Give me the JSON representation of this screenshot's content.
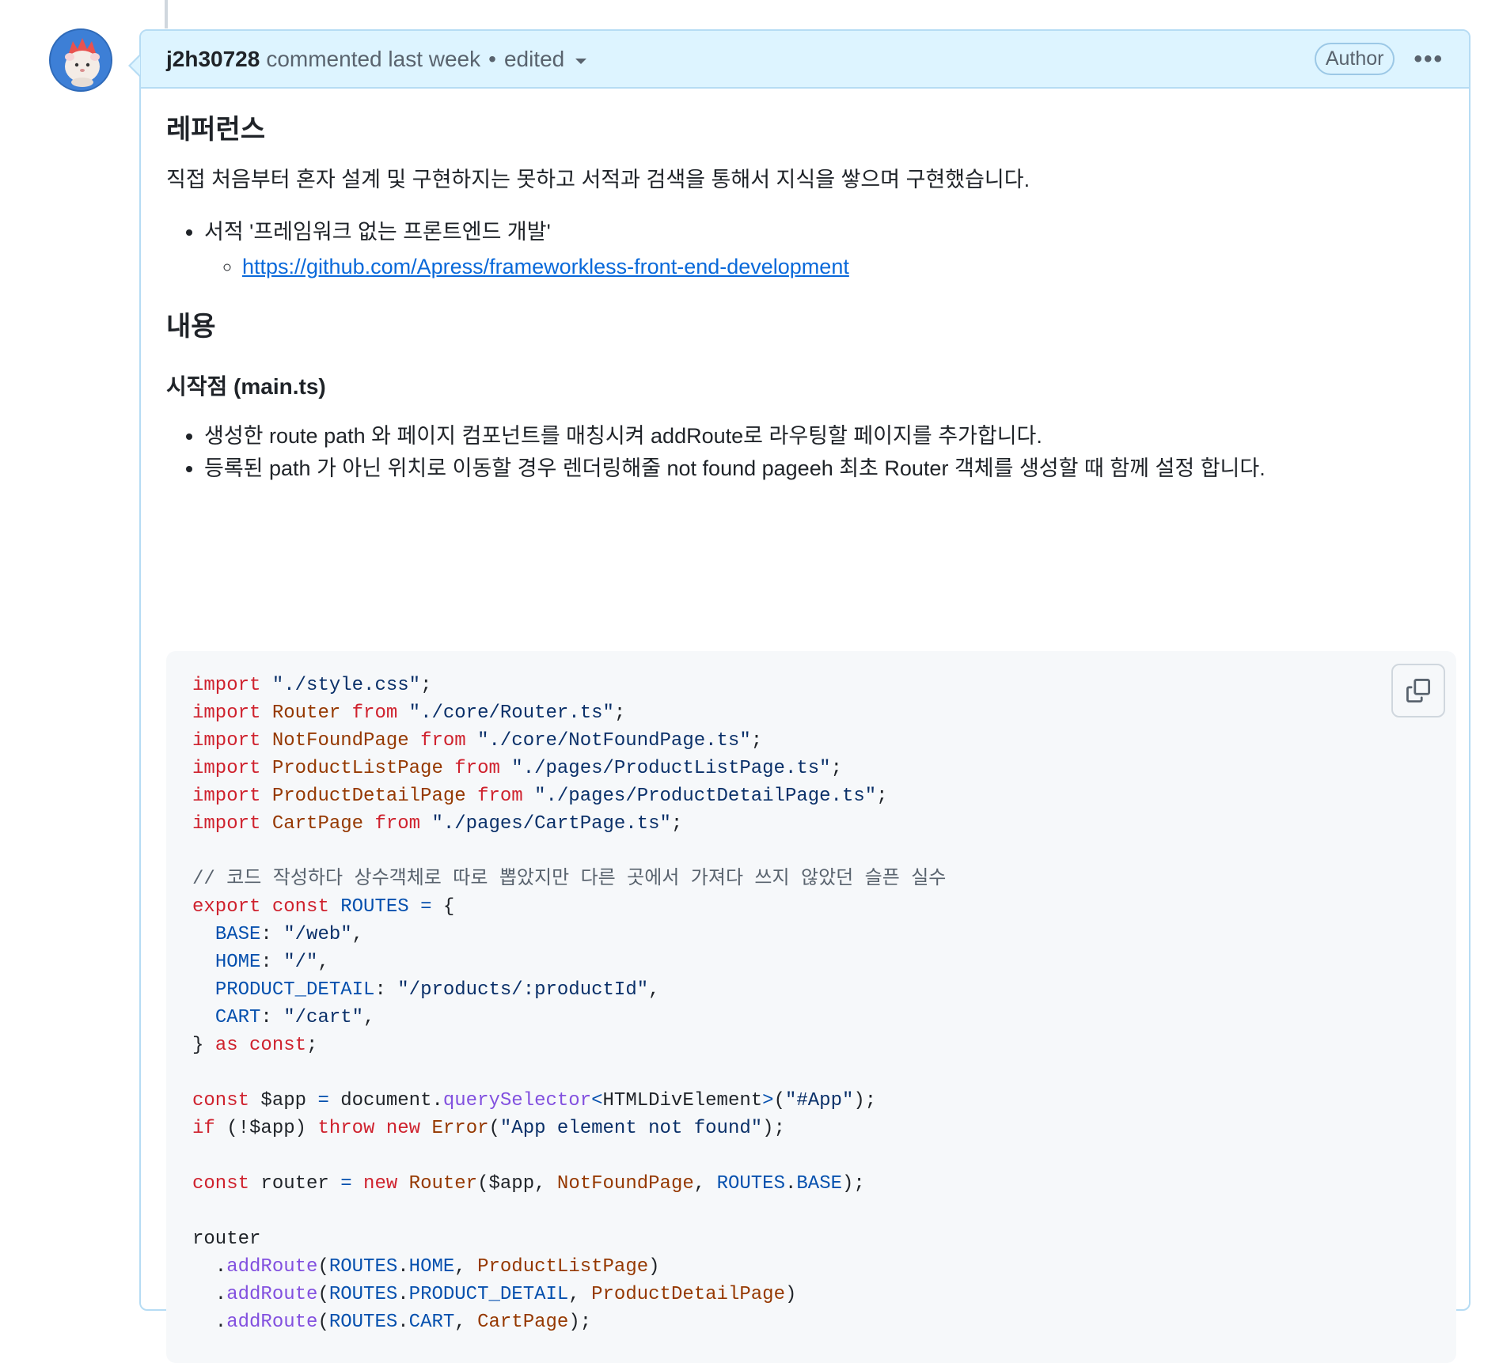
{
  "comment": {
    "author": "j2h30728",
    "action_text": "commented last week",
    "separator": "•",
    "edited_label": "edited",
    "author_badge": "Author",
    "menu_label": "•••"
  },
  "content": {
    "heading_reference": "레퍼런스",
    "intro": "직접 처음부터 혼자 설계 및 구현하지는 못하고 서적과 검색을 통해서 지식을 쌓으며 구현했습니다.",
    "book_item": "서적 '프레임워크 없는 프론트엔드 개발'",
    "book_link": "https://github.com/Apress/frameworkless-front-end-development",
    "heading_content": "내용",
    "subheading_entry": "시작점 (main.ts)",
    "bullet_1": "생성한 route path 와 페이지 컴포넌트를 매칭시켜 addRoute로 라우팅할 페이지를 추가합니다.",
    "bullet_2": "등록된 path 가 아닌 위치로 이동할 경우 렌더링해줄 not found pageeh 최초 Router 객체를 생성할 때 함께 설정 합니다."
  },
  "code": {
    "language": "ts",
    "comment_line": "// 코드 작성하다 상수객체로 따로 뽑았지만 다른 곳에서 가져다 쓰지 않았던 슬픈 실수",
    "imports": [
      {
        "name": "",
        "path": "\"./style.css\""
      },
      {
        "name": "Router",
        "path": "\"./core/Router.ts\""
      },
      {
        "name": "NotFoundPage",
        "path": "\"./core/NotFoundPage.ts\""
      },
      {
        "name": "ProductListPage",
        "path": "\"./pages/ProductListPage.ts\""
      },
      {
        "name": "ProductDetailPage",
        "path": "\"./pages/ProductDetailPage.ts\""
      },
      {
        "name": "CartPage",
        "path": "\"./pages/CartPage.ts\""
      }
    ],
    "routes": [
      {
        "key": "BASE",
        "value": "\"/web\""
      },
      {
        "key": "HOME",
        "value": "\"/\""
      },
      {
        "key": "PRODUCT_DETAIL",
        "value": "\"/products/:productId\""
      },
      {
        "key": "CART",
        "value": "\"/cart\""
      }
    ]
  },
  "colors": {
    "header_bg": "#ddf4ff",
    "header_border": "#b6dcf4",
    "link": "#0969da",
    "code_bg": "#f6f8fa",
    "keyword": "#cf222e",
    "string": "#0a3069"
  },
  "icons": {
    "avatar": "hamster-avatar",
    "copy": "copy-icon",
    "caret": "caret-down-icon",
    "kebab": "kebab-horizontal-icon"
  }
}
